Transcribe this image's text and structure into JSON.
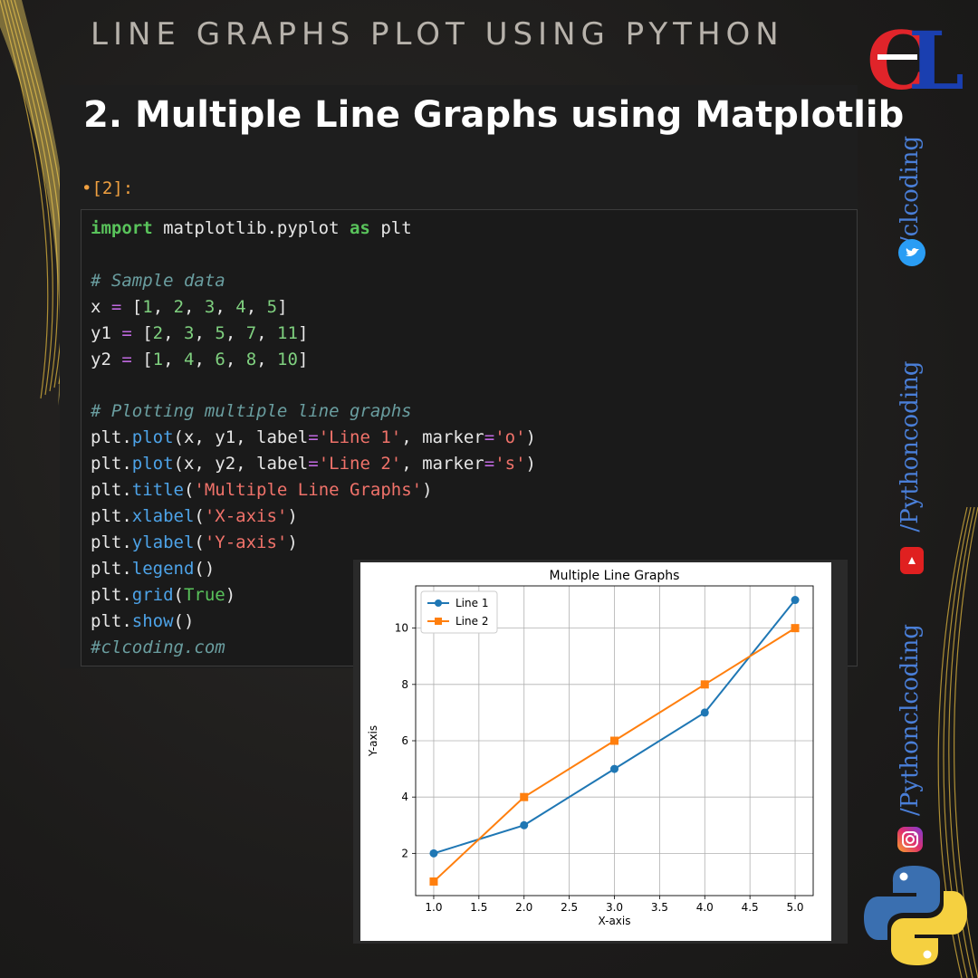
{
  "header": {
    "title": "LINE GRAPHS PLOT USING PYTHON",
    "logo_text": "CL"
  },
  "panel": {
    "heading": "2. Multiple Line Graphs using Matplotlib",
    "prompt": "•[2]:"
  },
  "code": {
    "lines": [
      [
        {
          "c": "kw",
          "t": "import"
        },
        {
          "c": "",
          "t": " matplotlib.pyplot "
        },
        {
          "c": "kw",
          "t": "as"
        },
        {
          "c": "",
          "t": " plt"
        }
      ],
      [],
      [
        {
          "c": "cm",
          "t": "# Sample data"
        }
      ],
      [
        {
          "c": "",
          "t": "x "
        },
        {
          "c": "op",
          "t": "="
        },
        {
          "c": "",
          "t": " ["
        },
        {
          "c": "num",
          "t": "1"
        },
        {
          "c": "",
          "t": ", "
        },
        {
          "c": "num",
          "t": "2"
        },
        {
          "c": "",
          "t": ", "
        },
        {
          "c": "num",
          "t": "3"
        },
        {
          "c": "",
          "t": ", "
        },
        {
          "c": "num",
          "t": "4"
        },
        {
          "c": "",
          "t": ", "
        },
        {
          "c": "num",
          "t": "5"
        },
        {
          "c": "",
          "t": "]"
        }
      ],
      [
        {
          "c": "",
          "t": "y1 "
        },
        {
          "c": "op",
          "t": "="
        },
        {
          "c": "",
          "t": " ["
        },
        {
          "c": "num",
          "t": "2"
        },
        {
          "c": "",
          "t": ", "
        },
        {
          "c": "num",
          "t": "3"
        },
        {
          "c": "",
          "t": ", "
        },
        {
          "c": "num",
          "t": "5"
        },
        {
          "c": "",
          "t": ", "
        },
        {
          "c": "num",
          "t": "7"
        },
        {
          "c": "",
          "t": ", "
        },
        {
          "c": "num",
          "t": "11"
        },
        {
          "c": "",
          "t": "]"
        }
      ],
      [
        {
          "c": "",
          "t": "y2 "
        },
        {
          "c": "op",
          "t": "="
        },
        {
          "c": "",
          "t": " ["
        },
        {
          "c": "num",
          "t": "1"
        },
        {
          "c": "",
          "t": ", "
        },
        {
          "c": "num",
          "t": "4"
        },
        {
          "c": "",
          "t": ", "
        },
        {
          "c": "num",
          "t": "6"
        },
        {
          "c": "",
          "t": ", "
        },
        {
          "c": "num",
          "t": "8"
        },
        {
          "c": "",
          "t": ", "
        },
        {
          "c": "num",
          "t": "10"
        },
        {
          "c": "",
          "t": "]"
        }
      ],
      [],
      [
        {
          "c": "cm",
          "t": "# Plotting multiple line graphs"
        }
      ],
      [
        {
          "c": "",
          "t": "plt."
        },
        {
          "c": "fn",
          "t": "plot"
        },
        {
          "c": "",
          "t": "(x, y1, label"
        },
        {
          "c": "op",
          "t": "="
        },
        {
          "c": "str",
          "t": "'Line 1'"
        },
        {
          "c": "",
          "t": ", marker"
        },
        {
          "c": "op",
          "t": "="
        },
        {
          "c": "str",
          "t": "'o'"
        },
        {
          "c": "",
          "t": ")"
        }
      ],
      [
        {
          "c": "",
          "t": "plt."
        },
        {
          "c": "fn",
          "t": "plot"
        },
        {
          "c": "",
          "t": "(x, y2, label"
        },
        {
          "c": "op",
          "t": "="
        },
        {
          "c": "str",
          "t": "'Line 2'"
        },
        {
          "c": "",
          "t": ", marker"
        },
        {
          "c": "op",
          "t": "="
        },
        {
          "c": "str",
          "t": "'s'"
        },
        {
          "c": "",
          "t": ")"
        }
      ],
      [
        {
          "c": "",
          "t": "plt."
        },
        {
          "c": "fn",
          "t": "title"
        },
        {
          "c": "",
          "t": "("
        },
        {
          "c": "str",
          "t": "'Multiple Line Graphs'"
        },
        {
          "c": "",
          "t": ")"
        }
      ],
      [
        {
          "c": "",
          "t": "plt."
        },
        {
          "c": "fn",
          "t": "xlabel"
        },
        {
          "c": "",
          "t": "("
        },
        {
          "c": "str",
          "t": "'X-axis'"
        },
        {
          "c": "",
          "t": ")"
        }
      ],
      [
        {
          "c": "",
          "t": "plt."
        },
        {
          "c": "fn",
          "t": "ylabel"
        },
        {
          "c": "",
          "t": "("
        },
        {
          "c": "str",
          "t": "'Y-axis'"
        },
        {
          "c": "",
          "t": ")"
        }
      ],
      [
        {
          "c": "",
          "t": "plt."
        },
        {
          "c": "fn",
          "t": "legend"
        },
        {
          "c": "",
          "t": "()"
        }
      ],
      [
        {
          "c": "",
          "t": "plt."
        },
        {
          "c": "fn",
          "t": "grid"
        },
        {
          "c": "",
          "t": "("
        },
        {
          "c": "tr",
          "t": "True"
        },
        {
          "c": "",
          "t": ")"
        }
      ],
      [
        {
          "c": "",
          "t": "plt."
        },
        {
          "c": "fn",
          "t": "show"
        },
        {
          "c": "",
          "t": "()"
        }
      ],
      [
        {
          "c": "cm",
          "t": "#clcoding.com"
        }
      ]
    ]
  },
  "social": {
    "twitter": "/clcoding",
    "youtube": "/Pythoncoding",
    "instagram": "/Pythonclcoding"
  },
  "colors": {
    "line1": "#1f77b4",
    "line2": "#ff7f0e",
    "accent_blue": "#4a7fd8",
    "logo_red": "#e0242a",
    "logo_blue": "#1a3fb0"
  },
  "chart_data": {
    "type": "line",
    "title": "Multiple Line Graphs",
    "xlabel": "X-axis",
    "ylabel": "Y-axis",
    "x": [
      1,
      2,
      3,
      4,
      5
    ],
    "series": [
      {
        "name": "Line 1",
        "values": [
          2,
          3,
          5,
          7,
          11
        ],
        "marker": "circle",
        "color": "#1f77b4"
      },
      {
        "name": "Line 2",
        "values": [
          1,
          4,
          6,
          8,
          10
        ],
        "marker": "square",
        "color": "#ff7f0e"
      }
    ],
    "xlim": [
      0.8,
      5.2
    ],
    "ylim": [
      0.5,
      11.5
    ],
    "xticks": [
      "1.0",
      "1.5",
      "2.0",
      "2.5",
      "3.0",
      "3.5",
      "4.0",
      "4.5",
      "5.0"
    ],
    "yticks": [
      "2",
      "4",
      "6",
      "8",
      "10"
    ],
    "grid": true,
    "legend": "top-left"
  }
}
